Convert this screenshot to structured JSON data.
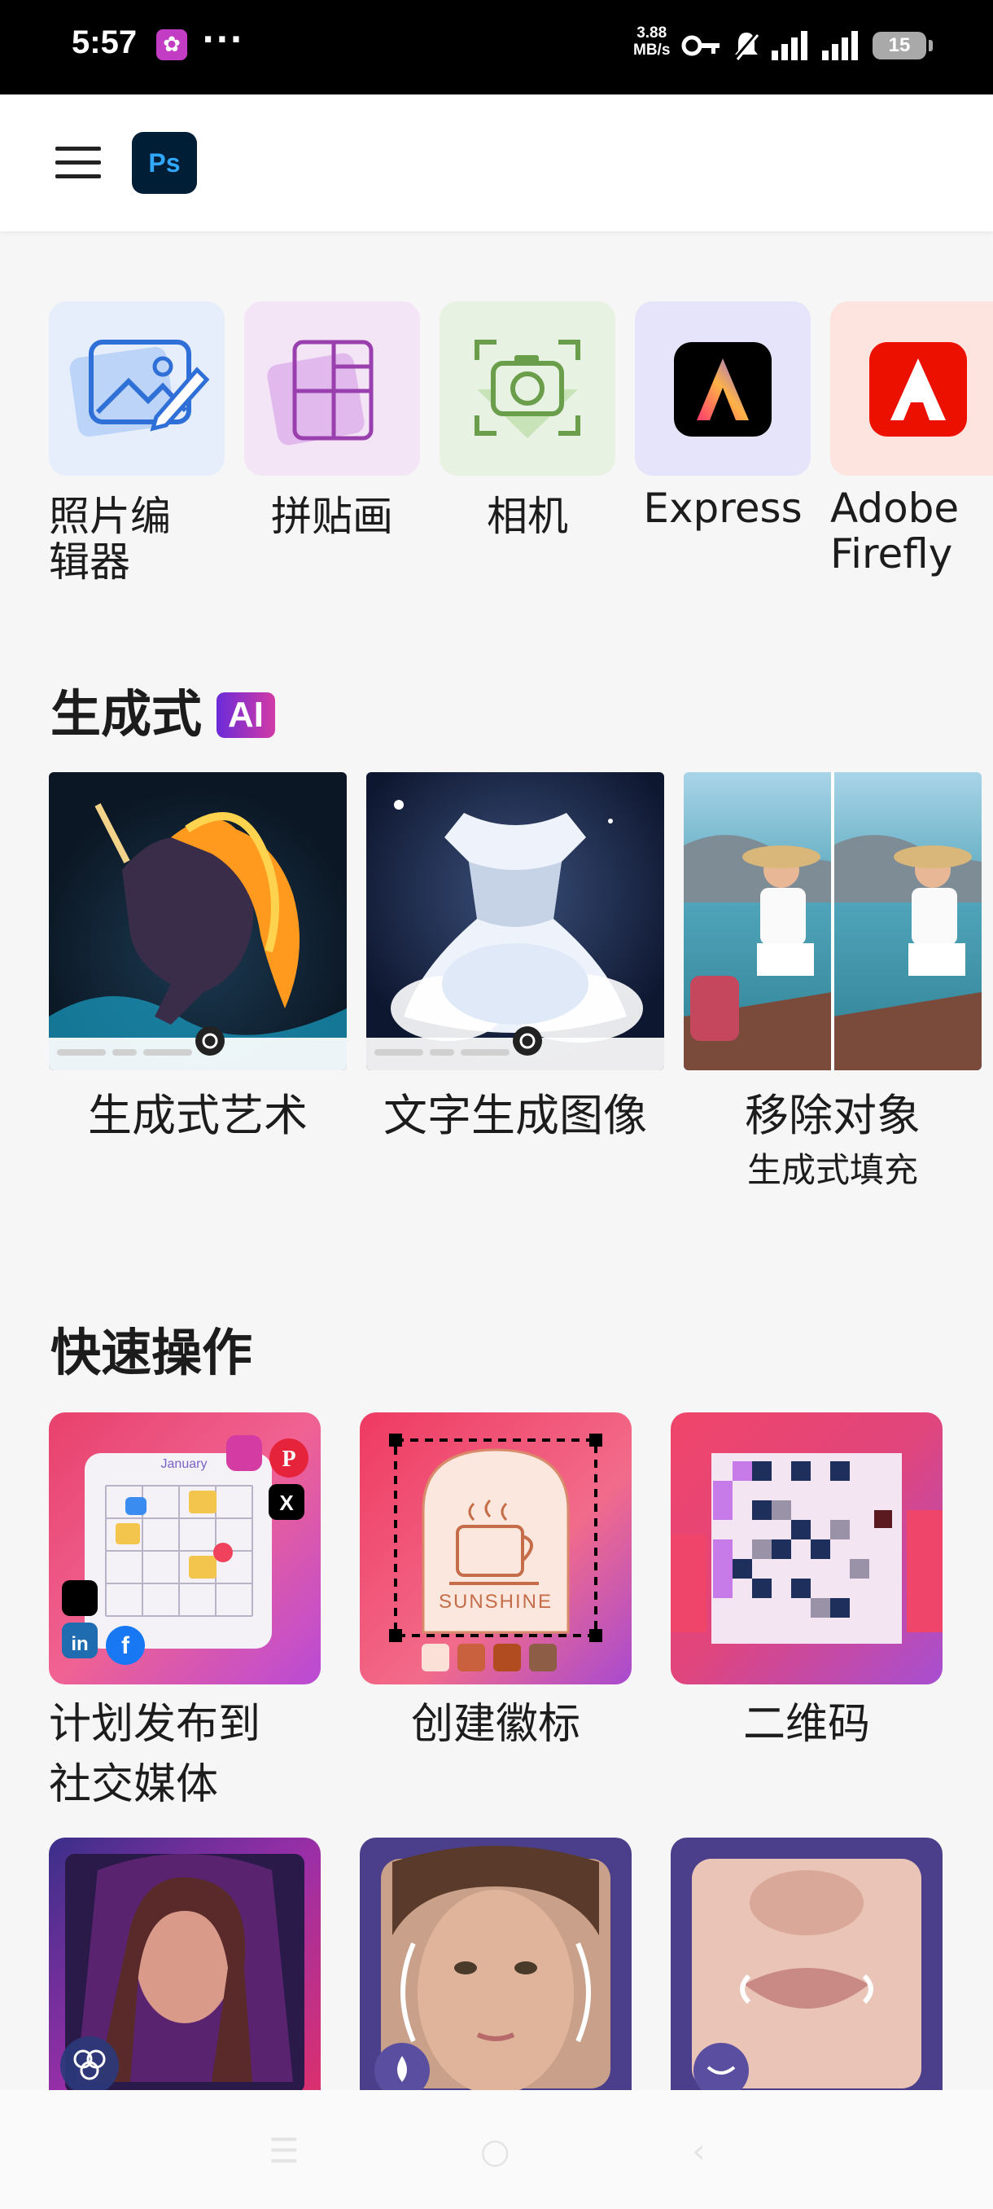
{
  "status_bar": {
    "time": "5:57",
    "more": "···",
    "speed_value": "3.88",
    "speed_unit": "MB/s",
    "battery": "15"
  },
  "app_bar": {
    "logo_text": "Ps"
  },
  "tools": [
    {
      "label": "照片编辑器",
      "icon": "photo-edit-icon",
      "bg": "#e6eefc"
    },
    {
      "label": "拼贴画",
      "icon": "collage-icon",
      "bg": "#f3e4f6"
    },
    {
      "label": "相机",
      "icon": "camera-icon",
      "bg": "#e8f2e2"
    },
    {
      "label": "Express",
      "icon": "adobe-express-icon",
      "bg": "#e6e4fb"
    },
    {
      "label": "Adobe Firefly",
      "icon": "adobe-firefly-icon",
      "bg": "#fde4de"
    }
  ],
  "generative": {
    "title": "生成式",
    "badge": "AI",
    "cards": [
      {
        "title": "生成式艺术"
      },
      {
        "title": "文字生成图像"
      },
      {
        "title": "移除对象",
        "subtitle": "生成式填充"
      }
    ]
  },
  "quick_actions": {
    "title": "快速操作",
    "cards": [
      {
        "title": "计划发布到社交媒体",
        "calendar_month": "January"
      },
      {
        "title": "创建徽标",
        "logo_text": "SUNSHINE"
      },
      {
        "title": "二维码"
      }
    ]
  }
}
